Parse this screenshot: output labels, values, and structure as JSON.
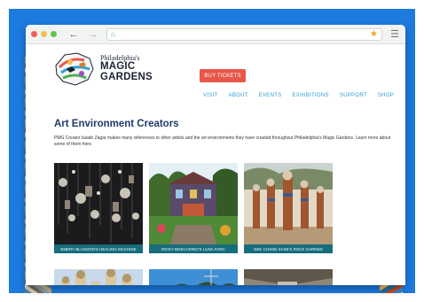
{
  "browser": {
    "address": "",
    "back_icon": "←",
    "forward_icon": "→",
    "lock_icon": "⌂",
    "star_icon": "★",
    "menu_icon": "☰"
  },
  "brand": {
    "line1": "Philadelphia's",
    "line2": "MAGIC",
    "line3": "GARDENS"
  },
  "header": {
    "buy_label": "BUY TICKETS",
    "nav": [
      "VISIT",
      "ABOUT",
      "EVENTS",
      "EXHIBITIONS",
      "SUPPORT",
      "SHOP"
    ]
  },
  "main": {
    "title": "Art Environment Creators",
    "intro": "PMG Creator Isaiah Zagar makes many references to other artists and the art environments they have created throughout Philadelphia's Magic Gardens. Learn more about some of them here.",
    "cards": [
      {
        "caption": "EMERY BLAGDON'S HEALING MACHINE"
      },
      {
        "caption": "RICKY BOSCARINO'S LUNA PARC"
      },
      {
        "caption": "NEK CHAND SAINI'S ROCK GARDEN"
      }
    ]
  },
  "colors": {
    "backdrop": "#1d7be0",
    "accent_button": "#e8574a",
    "nav_link": "#2c9fd4",
    "title": "#1e3a6e",
    "caption_bar": "#176d7c"
  }
}
